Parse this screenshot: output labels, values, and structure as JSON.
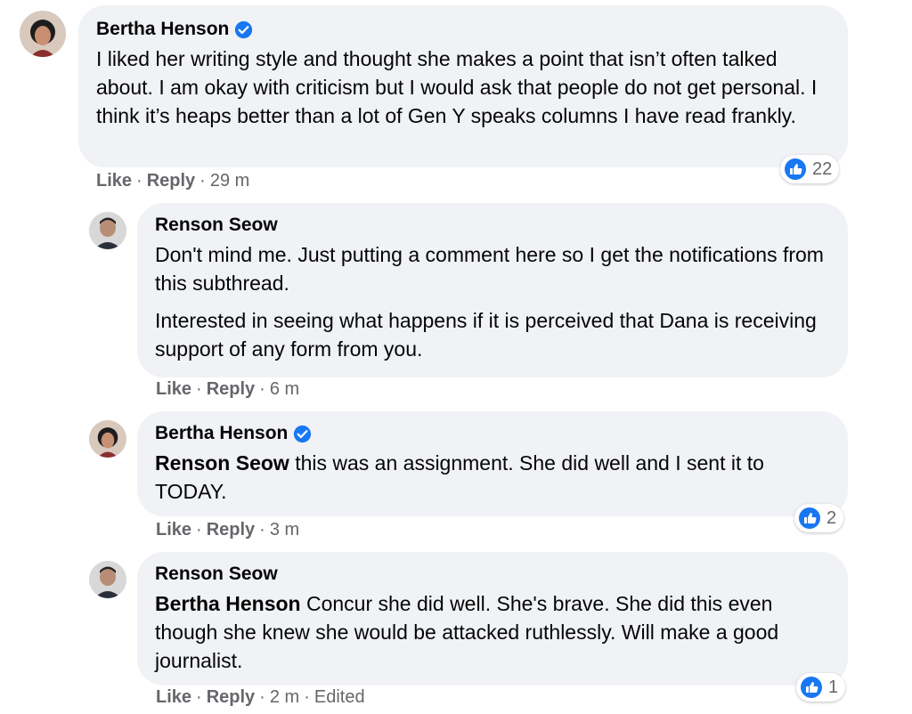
{
  "colors": {
    "like_blue": "#1877f2",
    "bubble_bg": "#f0f2f5",
    "meta_gray": "#65676b"
  },
  "icons": {
    "verified": "verified-badge-icon",
    "like": "like-reaction-icon",
    "avatar": "avatar"
  },
  "comments": [
    {
      "author": "Bertha Henson",
      "verified": true,
      "paragraphs": [
        {
          "mention": "",
          "text": "I liked her writing style and thought she makes a point that isn’t often talked about. I am okay with criticism but I would ask that people do not get personal. I think it’s heaps better than a lot of Gen Y speaks columns I have read frankly."
        }
      ],
      "like_label": "Like",
      "reply_label": "Reply",
      "time": "29 m",
      "edited": "",
      "reaction_count": "22"
    },
    {
      "author": "Renson Seow",
      "verified": false,
      "paragraphs": [
        {
          "mention": "",
          "text": "Don't mind me. Just putting a comment here so I get the notifications from this subthread."
        },
        {
          "mention": "",
          "text": "Interested in seeing what happens if it is perceived that Dana is receiving support of any form from you."
        }
      ],
      "like_label": "Like",
      "reply_label": "Reply",
      "time": "6 m",
      "edited": "",
      "reaction_count": ""
    },
    {
      "author": "Bertha Henson",
      "verified": true,
      "paragraphs": [
        {
          "mention": "Renson Seow",
          "text": " this was an assignment. She did well and I sent it to TODAY."
        }
      ],
      "like_label": "Like",
      "reply_label": "Reply",
      "time": "3 m",
      "edited": "",
      "reaction_count": "2"
    },
    {
      "author": "Renson Seow",
      "verified": false,
      "paragraphs": [
        {
          "mention": "Bertha Henson",
          "text": " Concur she did well. She's brave. She did this even though she knew she would be attacked ruthlessly. Will make a good journalist."
        }
      ],
      "like_label": "Like",
      "reply_label": "Reply",
      "time": "2 m",
      "edited": "Edited",
      "reaction_count": "1"
    }
  ]
}
